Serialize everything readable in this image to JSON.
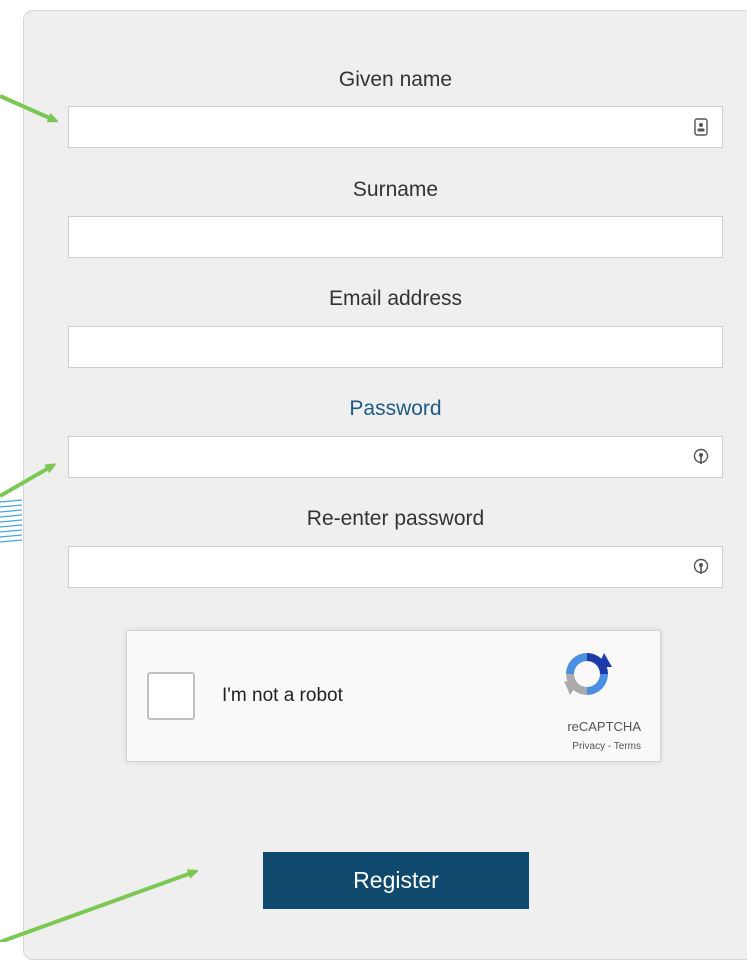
{
  "form": {
    "given_name": {
      "label": "Given name",
      "value": "",
      "icon": "contact-card-icon"
    },
    "surname": {
      "label": "Surname",
      "value": ""
    },
    "email": {
      "label": "Email address",
      "value": ""
    },
    "password": {
      "label": "Password",
      "value": "",
      "icon": "password-key-icon"
    },
    "reenter_password": {
      "label": "Re-enter password",
      "value": "",
      "icon": "password-key-icon"
    }
  },
  "captcha": {
    "checkbox_label": "I'm not a robot",
    "brand": "reCAPTCHA",
    "links": "Privacy - Terms",
    "checked": false
  },
  "register_button": {
    "label": "Register"
  },
  "colors": {
    "panel": "#efefef",
    "accent_label": "#1f5a85",
    "button": "#0f4a6e",
    "annotation_arrow": "#7dc855"
  }
}
